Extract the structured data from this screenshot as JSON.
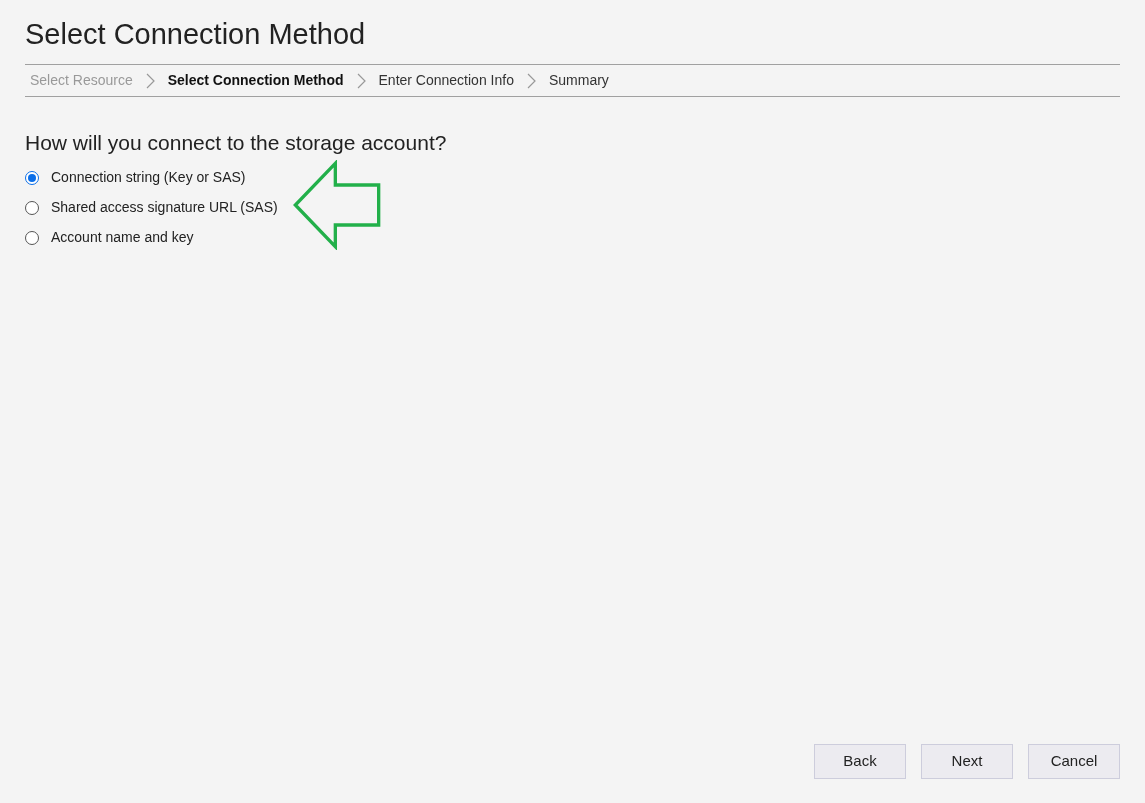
{
  "title": "Select Connection Method",
  "steps": [
    {
      "label": "Select Resource",
      "selected": false,
      "disabled": true
    },
    {
      "label": "Select Connection Method",
      "selected": true,
      "disabled": false
    },
    {
      "label": "Enter Connection Info",
      "selected": false,
      "disabled": false
    },
    {
      "label": "Summary",
      "selected": false,
      "disabled": false
    }
  ],
  "question": "How will you connect to the storage account?",
  "options": [
    {
      "label": "Connection string (Key or SAS)",
      "selected": true
    },
    {
      "label": "Shared access signature URL (SAS)",
      "selected": false
    },
    {
      "label": "Account name and key",
      "selected": false
    }
  ],
  "buttons": [
    "Back",
    "Next",
    "Cancel"
  ]
}
